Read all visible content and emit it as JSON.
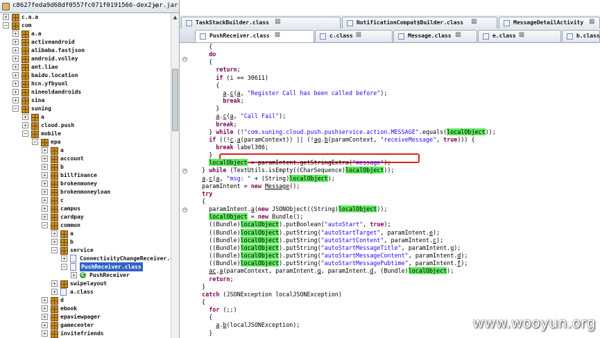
{
  "explorer": {
    "title": "c8627feda9d68df0557fc071f0191566-dex2jar.jar",
    "close_glyph": "✕",
    "tree": [
      {
        "label": "c.a.a",
        "depth": 0,
        "exp": "+",
        "icon": "pkg"
      },
      {
        "label": "com",
        "depth": 0,
        "exp": "−",
        "icon": "pkg"
      },
      {
        "label": "a.a",
        "depth": 1,
        "exp": "+",
        "icon": "pkg"
      },
      {
        "label": "activeandroid",
        "depth": 1,
        "exp": "+",
        "icon": "pkg"
      },
      {
        "label": "alibaba.fastjson",
        "depth": 1,
        "exp": "+",
        "icon": "pkg"
      },
      {
        "label": "android.volley",
        "depth": 1,
        "exp": "+",
        "icon": "pkg"
      },
      {
        "label": "ant.liao",
        "depth": 1,
        "exp": "+",
        "icon": "pkg"
      },
      {
        "label": "baidu.location",
        "depth": 1,
        "exp": "+",
        "icon": "pkg"
      },
      {
        "label": "hcn.yfbyunl",
        "depth": 1,
        "exp": "+",
        "icon": "pkg"
      },
      {
        "label": "nineoldandroids",
        "depth": 1,
        "exp": "+",
        "icon": "pkg"
      },
      {
        "label": "sina",
        "depth": 1,
        "exp": "+",
        "icon": "pkg"
      },
      {
        "label": "suning",
        "depth": 1,
        "exp": "−",
        "icon": "pkg"
      },
      {
        "label": "a",
        "depth": 2,
        "exp": "+",
        "icon": "pkg"
      },
      {
        "label": "cloud.push",
        "depth": 2,
        "exp": "+",
        "icon": "pkg"
      },
      {
        "label": "mobile",
        "depth": 2,
        "exp": "−",
        "icon": "pkg"
      },
      {
        "label": "epa",
        "depth": 3,
        "exp": "−",
        "icon": "pkg"
      },
      {
        "label": "a",
        "depth": 4,
        "exp": "+",
        "icon": "pkg"
      },
      {
        "label": "account",
        "depth": 4,
        "exp": "+",
        "icon": "pkg"
      },
      {
        "label": "b",
        "depth": 4,
        "exp": "+",
        "icon": "pkg"
      },
      {
        "label": "billfinance",
        "depth": 4,
        "exp": "+",
        "icon": "pkg"
      },
      {
        "label": "brokenmoney",
        "depth": 4,
        "exp": "+",
        "icon": "pkg"
      },
      {
        "label": "brokenmoneyloan",
        "depth": 4,
        "exp": "+",
        "icon": "pkg"
      },
      {
        "label": "c",
        "depth": 4,
        "exp": "+",
        "icon": "pkg"
      },
      {
        "label": "campus",
        "depth": 4,
        "exp": "+",
        "icon": "pkg"
      },
      {
        "label": "cardpay",
        "depth": 4,
        "exp": "+",
        "icon": "pkg"
      },
      {
        "label": "common",
        "depth": 4,
        "exp": "−",
        "icon": "pkg"
      },
      {
        "label": "a",
        "depth": 5,
        "exp": "+",
        "icon": "pkg"
      },
      {
        "label": "b",
        "depth": 5,
        "exp": "+",
        "icon": "pkg"
      },
      {
        "label": "service",
        "depth": 5,
        "exp": "−",
        "icon": "pkg"
      },
      {
        "label": "ConnectivityChangeReceiver.cl",
        "depth": 6,
        "exp": "+",
        "icon": "file"
      },
      {
        "label": "PushReceiver.class",
        "depth": 6,
        "exp": "−",
        "icon": "file",
        "selected": true
      },
      {
        "label": "PushReceiver",
        "depth": 7,
        "exp": "+",
        "icon": "class"
      },
      {
        "label": "swipelayout",
        "depth": 5,
        "exp": "+",
        "icon": "pkg"
      },
      {
        "label": "a.class",
        "depth": 5,
        "exp": "+",
        "icon": "file"
      },
      {
        "label": "d",
        "depth": 4,
        "exp": "+",
        "icon": "pkg"
      },
      {
        "label": "ebook",
        "depth": 4,
        "exp": "+",
        "icon": "pkg"
      },
      {
        "label": "epaviewpager",
        "depth": 4,
        "exp": "+",
        "icon": "pkg"
      },
      {
        "label": "gamecenter",
        "depth": 4,
        "exp": "+",
        "icon": "pkg"
      },
      {
        "label": "invitefriends",
        "depth": 4,
        "exp": "+",
        "icon": "pkg"
      }
    ]
  },
  "editor": {
    "tabs_row1": [
      {
        "label": "TaskStackBuilder.class"
      },
      {
        "label": "NotificationCompat$Builder.class"
      },
      {
        "label": "MessageDetailActivity"
      }
    ],
    "tabs_row2": [
      {
        "label": "PushReceiver.class",
        "active": true
      },
      {
        "label": "c.class"
      },
      {
        "label": "Message.class"
      },
      {
        "label": "e.class"
      },
      {
        "label": "b.class"
      }
    ],
    "tab_close_glyph": "⊠",
    "code_lines": [
      [
        {
          "t": "      {"
        }
      ],
      [
        {
          "t": "      "
        },
        {
          "t": "do",
          "c": "k"
        }
      ],
      [
        {
          "t": "      {"
        }
      ],
      [
        {
          "t": "        "
        },
        {
          "t": "return",
          "c": "k"
        },
        {
          "t": ";"
        }
      ],
      [
        {
          "t": "        "
        },
        {
          "t": "if",
          "c": "k"
        },
        {
          "t": " (i == 30611)"
        }
      ],
      [
        {
          "t": "        {"
        }
      ],
      [
        {
          "t": "          "
        },
        {
          "t": "a",
          "c": "u"
        },
        {
          "t": "."
        },
        {
          "t": "c",
          "c": "u"
        },
        {
          "t": "("
        },
        {
          "t": "a",
          "c": "u"
        },
        {
          "t": ", "
        },
        {
          "t": "\"Register Call has been called before\"",
          "c": "s"
        },
        {
          "t": ");"
        }
      ],
      [
        {
          "t": "          "
        },
        {
          "t": "break",
          "c": "k"
        },
        {
          "t": ";"
        }
      ],
      [
        {
          "t": "        }"
        }
      ],
      [
        {
          "t": "        "
        },
        {
          "t": "a",
          "c": "u"
        },
        {
          "t": "."
        },
        {
          "t": "c",
          "c": "u"
        },
        {
          "t": "("
        },
        {
          "t": "a",
          "c": "u"
        },
        {
          "t": ", "
        },
        {
          "t": "\"Call Fail\"",
          "c": "s"
        },
        {
          "t": ");"
        }
      ],
      [
        {
          "t": "        "
        },
        {
          "t": "break",
          "c": "k"
        },
        {
          "t": ";"
        }
      ],
      [
        {
          "t": "      } "
        },
        {
          "t": "while",
          "c": "k"
        },
        {
          "t": " (!"
        },
        {
          "t": "\"com.suning.cloud.push.pushservice.action.MESSAGE\"",
          "c": "s"
        },
        {
          "t": ".equals("
        },
        {
          "t": "localObject",
          "c": "hl"
        },
        {
          "t": "));"
        }
      ],
      [
        {
          "t": "      "
        },
        {
          "t": "if",
          "c": "k"
        },
        {
          "t": " ((!"
        },
        {
          "t": "c",
          "c": "u"
        },
        {
          "t": "."
        },
        {
          "t": "a",
          "c": "u"
        },
        {
          "t": "(paramContext)) || (!"
        },
        {
          "t": "ag",
          "c": "u"
        },
        {
          "t": "."
        },
        {
          "t": "b",
          "c": "u"
        },
        {
          "t": "(paramContext, "
        },
        {
          "t": "\"receiveMessage\"",
          "c": "s"
        },
        {
          "t": ", "
        },
        {
          "t": "true",
          "c": "k"
        },
        {
          "t": "))) {"
        }
      ],
      [
        {
          "t": "        "
        },
        {
          "t": "break",
          "c": "k"
        },
        {
          "t": " label306;"
        }
      ],
      [
        {
          "t": "      }"
        }
      ],
      [
        {
          "t": "      "
        },
        {
          "t": "localObject",
          "c": "hl"
        },
        {
          "t": " = paramIntent.getStringExtra("
        },
        {
          "t": "\"message\"",
          "c": "s"
        },
        {
          "t": ");"
        }
      ],
      [
        {
          "t": "    } "
        },
        {
          "t": "while",
          "c": "k"
        },
        {
          "t": " (TextUtils.isEmpty((CharSequence)"
        },
        {
          "t": "localObject",
          "c": "hl"
        },
        {
          "t": "));"
        }
      ],
      [
        {
          "t": "    "
        },
        {
          "t": "a",
          "c": "u"
        },
        {
          "t": "."
        },
        {
          "t": "c",
          "c": "u"
        },
        {
          "t": "("
        },
        {
          "t": "a",
          "c": "u"
        },
        {
          "t": ", "
        },
        {
          "t": "\"msg: \"",
          "c": "s"
        },
        {
          "t": " + (String)"
        },
        {
          "t": "localObject",
          "c": "hl"
        },
        {
          "t": ");"
        }
      ],
      [
        {
          "t": "    paramIntent = "
        },
        {
          "t": "new",
          "c": "k"
        },
        {
          "t": " "
        },
        {
          "t": "Message",
          "c": "u"
        },
        {
          "t": "();"
        }
      ],
      [
        {
          "t": "    "
        },
        {
          "t": "try",
          "c": "k"
        }
      ],
      [
        {
          "t": "    {"
        }
      ],
      [
        {
          "t": "      paramIntent."
        },
        {
          "t": "a",
          "c": "u"
        },
        {
          "t": "("
        },
        {
          "t": "new",
          "c": "k"
        },
        {
          "t": " JSONObject((String)"
        },
        {
          "t": "localObject",
          "c": "hl"
        },
        {
          "t": "));"
        }
      ],
      [
        {
          "t": "      "
        },
        {
          "t": "localObject",
          "c": "hl"
        },
        {
          "t": " = "
        },
        {
          "t": "new",
          "c": "k"
        },
        {
          "t": " Bundle();"
        }
      ],
      [
        {
          "t": "      ((Bundle)"
        },
        {
          "t": "localObject",
          "c": "hl"
        },
        {
          "t": ").putBoolean("
        },
        {
          "t": "\"autoStart\"",
          "c": "s"
        },
        {
          "t": ", "
        },
        {
          "t": "true",
          "c": "k"
        },
        {
          "t": ");"
        }
      ],
      [
        {
          "t": "      ((Bundle)"
        },
        {
          "t": "localObject",
          "c": "hl"
        },
        {
          "t": ").putString("
        },
        {
          "t": "\"autoStartTarget\"",
          "c": "s"
        },
        {
          "t": ", paramIntent."
        },
        {
          "t": "e",
          "c": "u"
        },
        {
          "t": ");"
        }
      ],
      [
        {
          "t": "      ((Bundle)"
        },
        {
          "t": "localObject",
          "c": "hl"
        },
        {
          "t": ").putString("
        },
        {
          "t": "\"autoStartContent\"",
          "c": "s"
        },
        {
          "t": ", paramIntent."
        },
        {
          "t": "c",
          "c": "u"
        },
        {
          "t": ");"
        }
      ],
      [
        {
          "t": "      ((Bundle)"
        },
        {
          "t": "localObject",
          "c": "hl"
        },
        {
          "t": ").putString("
        },
        {
          "t": "\"autoStartMessageTitle\"",
          "c": "s"
        },
        {
          "t": ", paramIntent."
        },
        {
          "t": "g",
          "c": "u"
        },
        {
          "t": ");"
        }
      ],
      [
        {
          "t": "      ((Bundle)"
        },
        {
          "t": "localObject",
          "c": "hl"
        },
        {
          "t": ").putString("
        },
        {
          "t": "\"autoStartMessageContent\"",
          "c": "s"
        },
        {
          "t": ", paramIntent."
        },
        {
          "t": "d",
          "c": "u"
        },
        {
          "t": ");"
        }
      ],
      [
        {
          "t": "      ((Bundle)"
        },
        {
          "t": "localObject",
          "c": "hl"
        },
        {
          "t": ").putString("
        },
        {
          "t": "\"autoStartMessagePubtime\"",
          "c": "s"
        },
        {
          "t": ", paramIntent."
        },
        {
          "t": "f",
          "c": "u"
        },
        {
          "t": ");"
        }
      ],
      [
        {
          "t": "      "
        },
        {
          "t": "ac",
          "c": "u"
        },
        {
          "t": "."
        },
        {
          "t": "a",
          "c": "u"
        },
        {
          "t": "(paramContext, paramIntent."
        },
        {
          "t": "g",
          "c": "u"
        },
        {
          "t": ", paramIntent."
        },
        {
          "t": "d",
          "c": "u"
        },
        {
          "t": ", (Bundle)"
        },
        {
          "t": "localObject",
          "c": "hl"
        },
        {
          "t": ");"
        }
      ],
      [
        {
          "t": "      "
        },
        {
          "t": "return",
          "c": "k"
        },
        {
          "t": ";"
        }
      ],
      [
        {
          "t": "    }"
        }
      ],
      [
        {
          "t": "    "
        },
        {
          "t": "catch",
          "c": "k"
        },
        {
          "t": " (JSONException localJSONException)"
        }
      ],
      [
        {
          "t": "    {"
        }
      ],
      [
        {
          "t": "      "
        },
        {
          "t": "for",
          "c": "k"
        },
        {
          "t": " (;;)"
        }
      ],
      [
        {
          "t": "      {"
        }
      ],
      [
        {
          "t": "        "
        },
        {
          "t": "a",
          "c": "u"
        },
        {
          "t": "."
        },
        {
          "t": "b",
          "c": "u"
        },
        {
          "t": "(localJSONException);"
        }
      ],
      [
        {
          "t": "      }"
        }
      ],
      [
        {
          "t": "    }"
        }
      ]
    ]
  },
  "watermark": "www.wooyun.org",
  "colors": {
    "keyword": "#7f0055",
    "string": "#2a00ff",
    "highlight": "#5eea5e",
    "selection": "#3163c6",
    "annotation": "#e21d1d"
  }
}
